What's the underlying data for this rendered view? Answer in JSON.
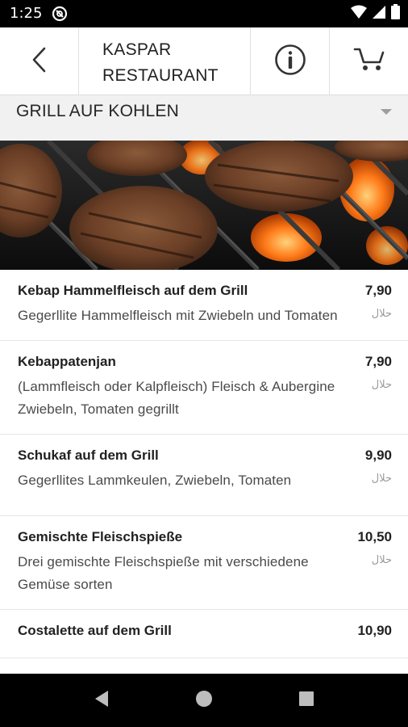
{
  "status_bar": {
    "time": "1:25",
    "icons": [
      "app-notification-icon",
      "wifi-icon",
      "cell-signal-icon",
      "battery-icon"
    ]
  },
  "app_bar": {
    "title_line1": "KASPAR",
    "title_line2": "RESTAURANT",
    "back_icon": "arrow-back-icon",
    "info_icon": "info-circle-icon",
    "cart_icon": "cart-icon"
  },
  "category": {
    "selected": "GRILL AUF KOHLEN",
    "dropdown_icon": "caret-down-icon"
  },
  "hero": {
    "description_icon": "grill-photo"
  },
  "menu": {
    "items": [
      {
        "name": "Kebap Hammelfleisch auf dem Grill",
        "description": "Gegerllite Hammelfleisch mit Zwiebeln und Tomaten",
        "price": "7,90",
        "tag": "حلال"
      },
      {
        "name": "Kebappatenjan",
        "description": "(Lammfleisch oder Kalpfleisch) Fleisch & Aubergine Zwiebeln, Tomaten gegrillt",
        "price": "7,90",
        "tag": "حلال"
      },
      {
        "name": "Schukaf auf dem Grill",
        "description": "Gegerllites Lammkeulen, Zwiebeln, Tomaten",
        "price": "9,90",
        "tag": "حلال"
      },
      {
        "name": "Gemischte Fleischspieße",
        "description": "Drei gemischte Fleischspieße mit verschiedene Gemüse sorten",
        "price": "10,50",
        "tag": "حلال"
      },
      {
        "name": "Costalette auf dem Grill",
        "description": "",
        "price": "10,90",
        "tag": ""
      }
    ]
  },
  "nav_bar": {
    "icons": [
      "nav-back-icon",
      "nav-home-icon",
      "nav-recents-icon"
    ]
  },
  "colors": {
    "status_bar_bg": "#000000",
    "app_bar_bg": "#ffffff",
    "category_bg": "#f1f1f1",
    "divider": "#e0e0e0",
    "flame": "#ff7a18"
  }
}
